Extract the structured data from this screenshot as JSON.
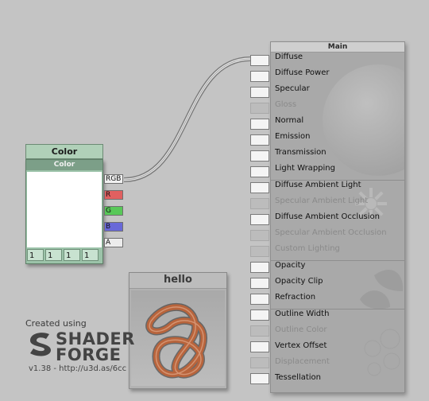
{
  "color_node": {
    "title": "Color",
    "header": "Color",
    "swatch_color": "#ffffff",
    "fields": [
      "1",
      "1",
      "1",
      "1"
    ],
    "outputs": [
      {
        "label": "RGB",
        "color": "#f0f0f0"
      },
      {
        "label": "R",
        "color": "#e06060"
      },
      {
        "label": "G",
        "color": "#58c858"
      },
      {
        "label": "B",
        "color": "#6868d8"
      },
      {
        "label": "A",
        "color": "#ececec"
      }
    ]
  },
  "preview_node": {
    "title": "hello",
    "knot_color": "#b8643c"
  },
  "main_node": {
    "title": "Main",
    "inputs": [
      {
        "label": "Diffuse",
        "enabled": true
      },
      {
        "label": "Diffuse Power",
        "enabled": true
      },
      {
        "label": "Specular",
        "enabled": true
      },
      {
        "label": "Gloss",
        "enabled": false
      },
      {
        "label": "Normal",
        "enabled": true
      },
      {
        "label": "Emission",
        "enabled": true
      },
      {
        "label": "Transmission",
        "enabled": true
      },
      {
        "label": "Light Wrapping",
        "enabled": true
      },
      {
        "label": "Diffuse Ambient Light",
        "enabled": true
      },
      {
        "label": "Specular Ambient Light",
        "enabled": false
      },
      {
        "label": "Diffuse Ambient Occlusion",
        "enabled": true
      },
      {
        "label": "Specular Ambient Occlusion",
        "enabled": false
      },
      {
        "label": "Custom Lighting",
        "enabled": false
      },
      {
        "label": "Opacity",
        "enabled": true
      },
      {
        "label": "Opacity Clip",
        "enabled": true
      },
      {
        "label": "Refraction",
        "enabled": true
      },
      {
        "label": "Outline Width",
        "enabled": true
      },
      {
        "label": "Outline Color",
        "enabled": false
      },
      {
        "label": "Vertex Offset",
        "enabled": true
      },
      {
        "label": "Displacement",
        "enabled": false
      },
      {
        "label": "Tessellation",
        "enabled": true
      }
    ]
  },
  "branding": {
    "created_using": "Created using",
    "logo_line1": "SHADER",
    "logo_line2": "FORGE",
    "version": "v1.38 - http://u3d.as/6cc"
  }
}
